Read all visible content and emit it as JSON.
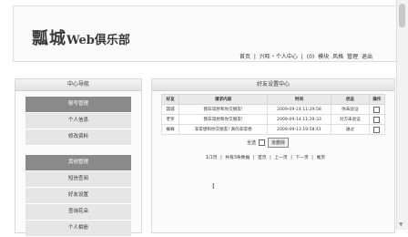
{
  "header": {
    "logo_main": "瓢城",
    "logo_sub": "Web俱乐部",
    "nav": {
      "home": "首页",
      "sep1": "|",
      "welcome": "兴旺・个人中心",
      "sep2": "|",
      "count": "(0)",
      "skin": "模块",
      "style": "风格",
      "manage": "管理",
      "logout": "退出"
    }
  },
  "sidebar": {
    "title": "中心导航",
    "group1": [
      "账号管理",
      "个人信息",
      "修改资料"
    ],
    "group2": [
      "其他管理",
      "短信查阅",
      "好友设置",
      "查询花朵",
      "个人相册"
    ]
  },
  "main": {
    "title": "好友设置中心",
    "columns": [
      "好友",
      "请求内容",
      "时间",
      "状态",
      "操作"
    ],
    "rows": [
      {
        "friend": "瓢城",
        "message": "我非常想和你交朋友!",
        "time": "2009-09-14 11:29:58",
        "status": "你未验证",
        "status_class": "st-pending"
      },
      {
        "friend": "老罗",
        "message": "我非常想和你交朋友!",
        "time": "2009-09-14 11:29:33",
        "status": "对方未验证",
        "status_class": "st-refuse"
      },
      {
        "friend": "蜘蛛",
        "message": "非常想和你交朋友! 真的非常想",
        "time": "2009-09-13 19:58:41",
        "status": "通过",
        "status_class": "st-pass"
      }
    ],
    "select_all": "全选",
    "batch_delete": "批删除",
    "pager": {
      "info": "1/1页",
      "sep": "|",
      "total": "共有3条数据",
      "first": "首页",
      "prev": "上一页",
      "next": "下一页",
      "last": "尾页"
    }
  }
}
